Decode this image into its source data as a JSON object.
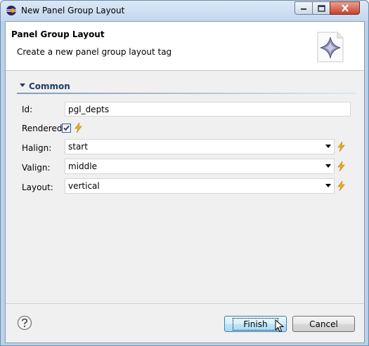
{
  "window": {
    "title": "New Panel Group Layout"
  },
  "header": {
    "title": "Panel Group Layout",
    "description": "Create a new panel group layout tag",
    "icon": "panel-layout-wizard-icon"
  },
  "section": {
    "title": "Common",
    "expanded": true
  },
  "fields": {
    "id": {
      "label": "Id:",
      "value": "pgl_depts"
    },
    "rendered": {
      "label": "Rendered:",
      "checked": true
    },
    "halign": {
      "label": "Halign:",
      "value": "start"
    },
    "valign": {
      "label": "Valign:",
      "value": "middle"
    },
    "layout": {
      "label": "Layout:",
      "value": "vertical"
    }
  },
  "buttons": {
    "finish": "Finish",
    "cancel": "Cancel"
  },
  "colors": {
    "accent": "#3c7fb1",
    "section_title": "#1f3b64",
    "bolt": "#f2b10e"
  }
}
